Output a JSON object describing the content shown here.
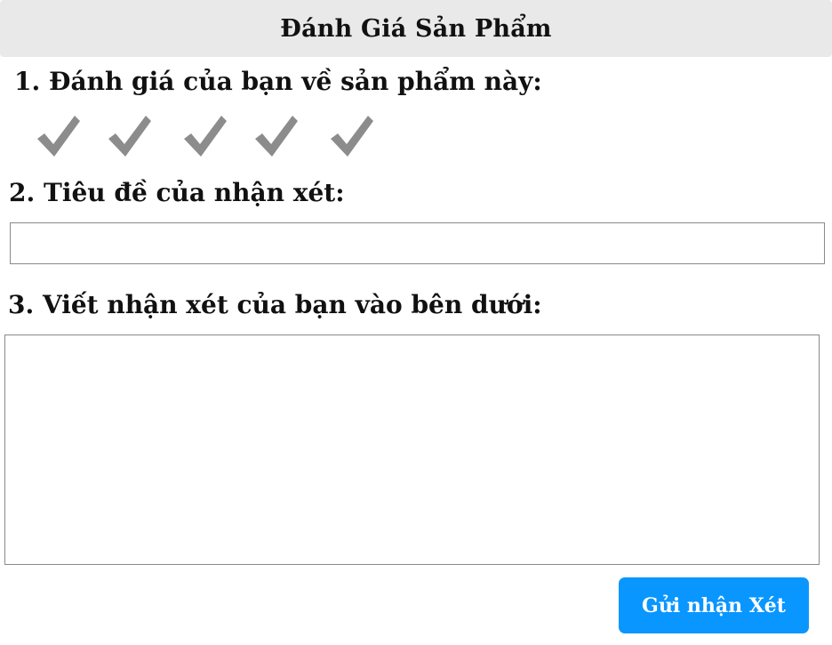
{
  "header": {
    "title": "Đánh Giá Sản Phẩm"
  },
  "rating": {
    "label": "1. Đánh giá của bạn về sản phẩm này:",
    "max": 5,
    "icon": "checkmark-icon",
    "icon_color": "#8c8c8c"
  },
  "review_title": {
    "label": "2. Tiêu đề của nhận xét:",
    "value": "",
    "placeholder": ""
  },
  "review_body": {
    "label": "3. Viết nhận xét của bạn vào bên dưới:",
    "value": "",
    "placeholder": ""
  },
  "actions": {
    "submit_label": "Gửi nhận Xét",
    "submit_color": "#0a96ff"
  }
}
